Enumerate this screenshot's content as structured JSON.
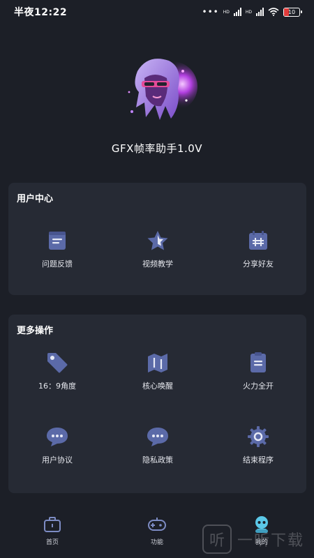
{
  "status_bar": {
    "time": "半夜12:22",
    "dots": "•••",
    "net1": "HD",
    "net2": "HD",
    "battery": "10"
  },
  "profile": {
    "app_title": "GFX帧率助手1.0V"
  },
  "user_center": {
    "title": "用户中心",
    "items": [
      {
        "label": "问题反馈",
        "icon": "feedback-document-icon"
      },
      {
        "label": "视频教学",
        "icon": "star-icon"
      },
      {
        "label": "分享好友",
        "icon": "share-calendar-icon"
      }
    ]
  },
  "more_actions": {
    "title": "更多操作",
    "items": [
      {
        "label": "16：9角度",
        "icon": "tag-icon"
      },
      {
        "label": "核心唤醒",
        "icon": "map-icon"
      },
      {
        "label": "火力全开",
        "icon": "clipboard-icon"
      },
      {
        "label": "用户协议",
        "icon": "chat-bubble-icon"
      },
      {
        "label": "隐私政策",
        "icon": "chat-bubble-icon"
      },
      {
        "label": "结束程序",
        "icon": "gear-icon"
      }
    ]
  },
  "bottom_nav": {
    "items": [
      {
        "label": "首页",
        "icon": "briefcase-icon"
      },
      {
        "label": "功能",
        "icon": "gamepad-icon"
      },
      {
        "label": "我的",
        "icon": "robot-icon"
      }
    ]
  },
  "watermark": {
    "logo": "听",
    "text": "一听下载"
  },
  "colors": {
    "background": "#1c1f27",
    "card": "#262a34",
    "icon_primary": "#5b6aa8",
    "icon_light": "#e6e9f5",
    "accent_active": "#5bc8e8"
  }
}
